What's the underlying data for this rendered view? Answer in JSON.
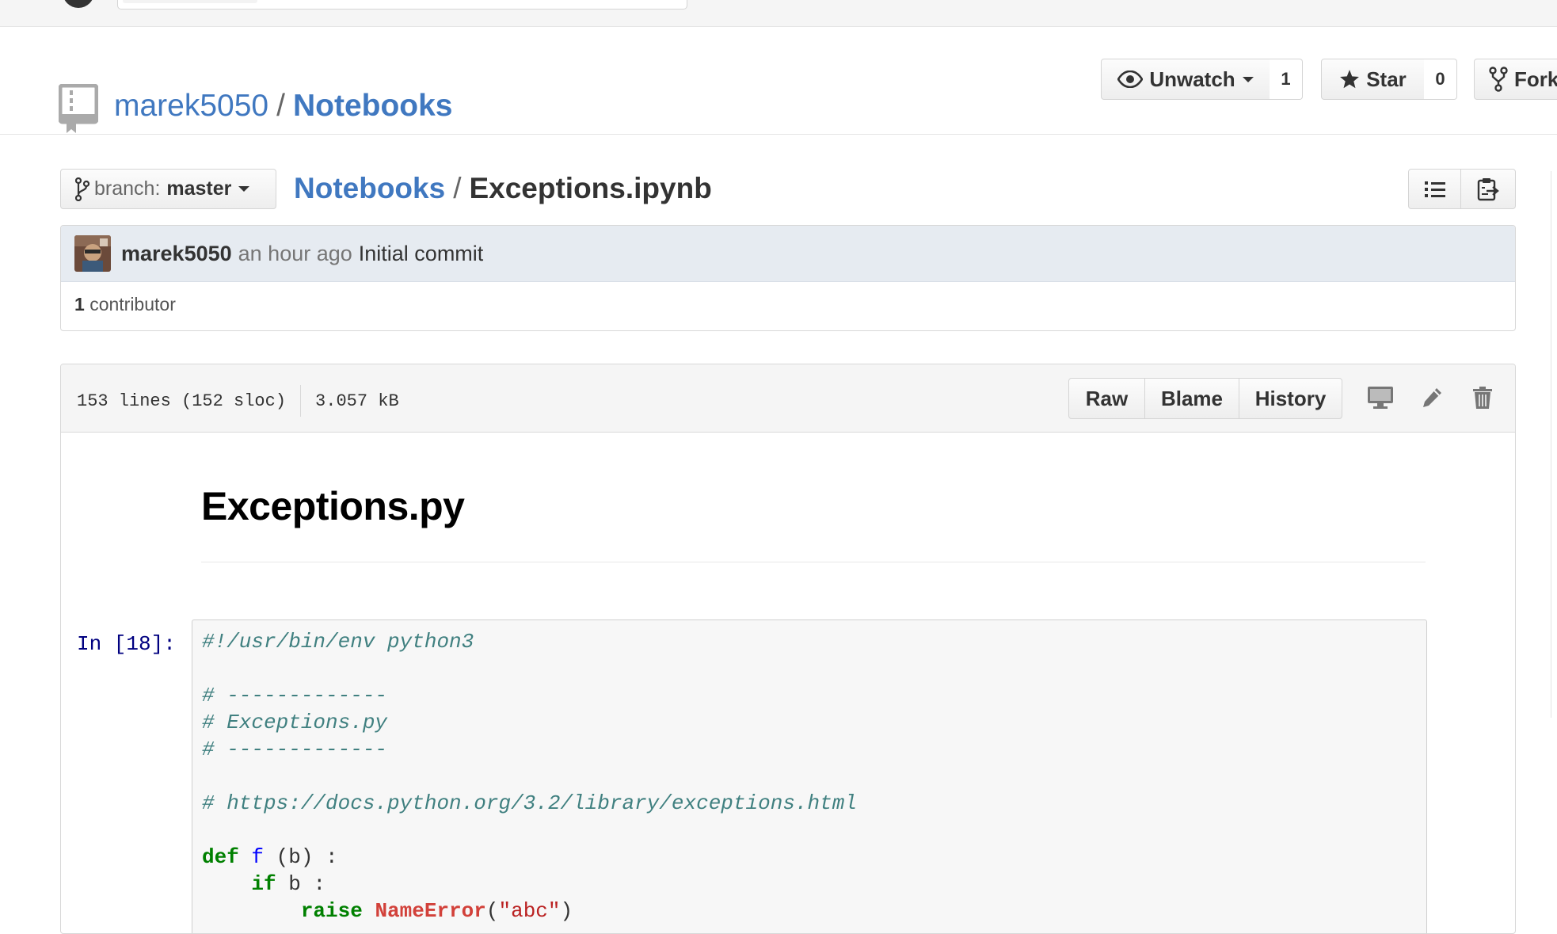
{
  "repo": {
    "owner": "marek5050",
    "separator": "/",
    "name": "Notebooks",
    "watch": {
      "label": "Unwatch",
      "count": "1"
    },
    "star": {
      "label": "Star",
      "count": "0"
    },
    "fork": {
      "label": "Fork"
    }
  },
  "file_nav": {
    "branch_label": "branch:",
    "branch_value": "master",
    "breadcrumb": {
      "root": "Notebooks",
      "separator": "/",
      "file": "Exceptions.ipynb"
    }
  },
  "commit": {
    "author": "marek5050",
    "time": "an hour ago",
    "message": "Initial commit",
    "contributors_count": "1",
    "contributors_label": "contributor"
  },
  "file": {
    "lines": "153 lines (152 sloc)",
    "size": "3.057 kB",
    "buttons": {
      "raw": "Raw",
      "blame": "Blame",
      "history": "History"
    }
  },
  "notebook": {
    "heading": "Exceptions.py",
    "prompt": "In [18]:",
    "code": {
      "shebang": "#!/usr/bin/env python3",
      "comment_rule_1": "# -------------",
      "comment_name": "# Exceptions.py",
      "comment_rule_2": "# -------------",
      "comment_url": "# https://docs.python.org/3.2/library/exceptions.html",
      "def_kw": "def",
      "def_name": "f",
      "def_rest": " (b) :",
      "if_kw": "if",
      "if_rest": " b :",
      "raise_kw": "raise",
      "raise_exc": "NameError",
      "raise_open": "(",
      "raise_str": "\"abc\"",
      "raise_close": ")"
    }
  }
}
